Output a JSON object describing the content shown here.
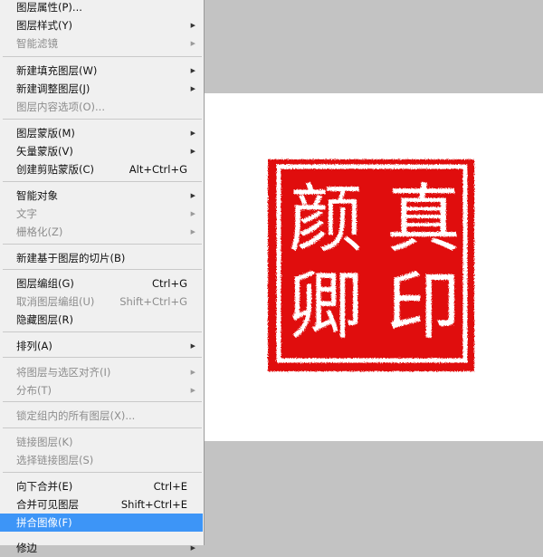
{
  "menu": {
    "items": [
      {
        "label": "图层属性(P)...",
        "shortcut": "",
        "submenu": false,
        "disabled": false
      },
      {
        "label": "图层样式(Y)",
        "shortcut": "",
        "submenu": true,
        "disabled": false
      },
      {
        "label": "智能滤镜",
        "shortcut": "",
        "submenu": true,
        "disabled": true
      },
      {
        "label": "新建填充图层(W)",
        "shortcut": "",
        "submenu": true,
        "disabled": false
      },
      {
        "label": "新建调整图层(J)",
        "shortcut": "",
        "submenu": true,
        "disabled": false
      },
      {
        "label": "图层内容选项(O)...",
        "shortcut": "",
        "submenu": false,
        "disabled": true
      },
      {
        "label": "图层蒙版(M)",
        "shortcut": "",
        "submenu": true,
        "disabled": false
      },
      {
        "label": "矢量蒙版(V)",
        "shortcut": "",
        "submenu": true,
        "disabled": false
      },
      {
        "label": "创建剪贴蒙版(C)",
        "shortcut": "Alt+Ctrl+G",
        "submenu": false,
        "disabled": false
      },
      {
        "label": "智能对象",
        "shortcut": "",
        "submenu": true,
        "disabled": false
      },
      {
        "label": "文字",
        "shortcut": "",
        "submenu": true,
        "disabled": true
      },
      {
        "label": "栅格化(Z)",
        "shortcut": "",
        "submenu": true,
        "disabled": true
      },
      {
        "label": "新建基于图层的切片(B)",
        "shortcut": "",
        "submenu": false,
        "disabled": false
      },
      {
        "label": "图层编组(G)",
        "shortcut": "Ctrl+G",
        "submenu": false,
        "disabled": false
      },
      {
        "label": "取消图层编组(U)",
        "shortcut": "Shift+Ctrl+G",
        "submenu": false,
        "disabled": true
      },
      {
        "label": "隐藏图层(R)",
        "shortcut": "",
        "submenu": false,
        "disabled": false
      },
      {
        "label": "排列(A)",
        "shortcut": "",
        "submenu": true,
        "disabled": false
      },
      {
        "label": "将图层与选区对齐(I)",
        "shortcut": "",
        "submenu": true,
        "disabled": true
      },
      {
        "label": "分布(T)",
        "shortcut": "",
        "submenu": true,
        "disabled": true
      },
      {
        "label": "锁定组内的所有图层(X)...",
        "shortcut": "",
        "submenu": false,
        "disabled": true
      },
      {
        "label": "链接图层(K)",
        "shortcut": "",
        "submenu": false,
        "disabled": true
      },
      {
        "label": "选择链接图层(S)",
        "shortcut": "",
        "submenu": false,
        "disabled": true
      },
      {
        "label": "向下合并(E)",
        "shortcut": "Ctrl+E",
        "submenu": false,
        "disabled": false
      },
      {
        "label": "合并可见图层",
        "shortcut": "Shift+Ctrl+E",
        "submenu": false,
        "disabled": false
      },
      {
        "label": "拼合图像(F)",
        "shortcut": "",
        "submenu": false,
        "disabled": false,
        "active": true
      },
      {
        "label": "修边",
        "shortcut": "",
        "submenu": true,
        "disabled": false
      }
    ],
    "arrow_glyph": "▶"
  },
  "canvas": {
    "stamp": {
      "color": "#e01010",
      "characters": [
        "真",
        "印",
        "颜",
        "卿"
      ]
    }
  },
  "colors": {
    "menu_bg": "#f0f0f0",
    "highlight": "#3d95f7",
    "canvas_bg": "#c3c3c3",
    "document_bg": "#ffffff"
  }
}
